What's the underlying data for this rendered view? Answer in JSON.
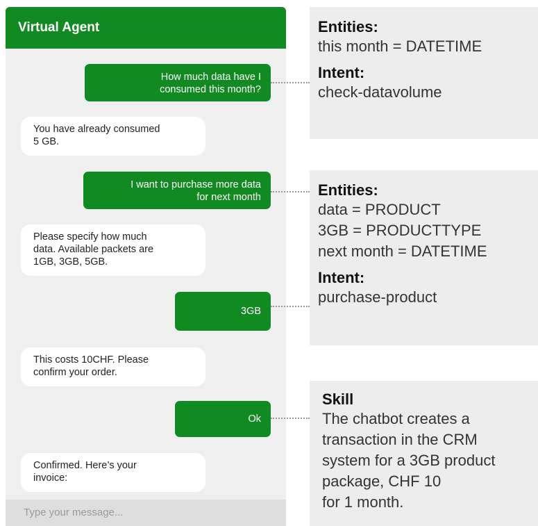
{
  "chat": {
    "header_title": "Virtual Agent",
    "messages": [
      {
        "sender": "user",
        "text": "How much data have I\nconsumed this month?"
      },
      {
        "sender": "agent",
        "text": "You have already consumed\n5 GB."
      },
      {
        "sender": "user",
        "text": "I want to purchase more data\nfor next month"
      },
      {
        "sender": "agent",
        "text": "Please specify how much\ndata. Available packets are\n1GB, 3GB, 5GB."
      },
      {
        "sender": "user",
        "text": "3GB"
      },
      {
        "sender": "agent",
        "text": "This costs 10CHF. Please\nconfirm your order."
      },
      {
        "sender": "user",
        "text": "Ok"
      },
      {
        "sender": "agent",
        "text": "Confirmed. Here’s your\ninvoice:"
      }
    ],
    "input_placeholder": "Type your message..."
  },
  "annotations": [
    {
      "entities_heading": "Entities:",
      "entities": [
        "this month = DATETIME"
      ],
      "intent_heading": "Intent:",
      "intent": "check-datavolume"
    },
    {
      "entities_heading": "Entities:",
      "entities": [
        "data = PRODUCT",
        "3GB = PRODUCTTYPE",
        "next month = DATETIME"
      ],
      "intent_heading": "Intent:",
      "intent": "purchase-product"
    },
    {
      "skill_heading": "Skill",
      "skill_lines": [
        "The chatbot creates a",
        "transaction in the CRM",
        "system for a 3GB product",
        "package, CHF 10",
        "for 1 month."
      ]
    }
  ],
  "colors": {
    "brand_green": "#128a22",
    "panel_gray": "#efefef",
    "note_gray": "#ededed"
  }
}
